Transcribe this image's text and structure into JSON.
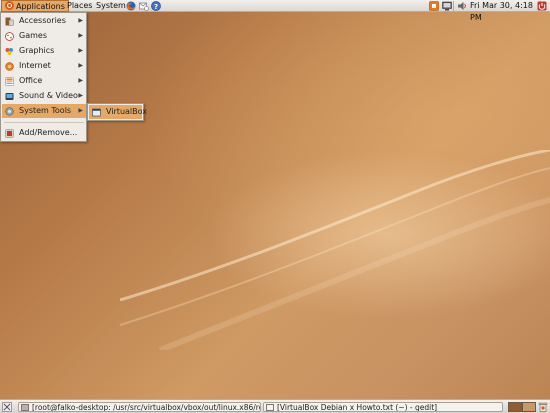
{
  "top_panel": {
    "menus": [
      "Applications",
      "Places",
      "System"
    ],
    "clock": "Fri Mar 30,  4:18 PM"
  },
  "applications_menu": {
    "items": [
      {
        "label": "Accessories",
        "icon": "accessories-icon",
        "has_submenu": true
      },
      {
        "label": "Games",
        "icon": "games-icon",
        "has_submenu": true
      },
      {
        "label": "Graphics",
        "icon": "graphics-icon",
        "has_submenu": true
      },
      {
        "label": "Internet",
        "icon": "internet-icon",
        "has_submenu": true
      },
      {
        "label": "Office",
        "icon": "office-icon",
        "has_submenu": true
      },
      {
        "label": "Sound & Video",
        "icon": "sound-video-icon",
        "has_submenu": true
      },
      {
        "label": "System Tools",
        "icon": "system-tools-icon",
        "has_submenu": true,
        "highlighted": true
      }
    ],
    "add_remove": "Add/Remove..."
  },
  "submenu": {
    "items": [
      {
        "label": "VirtualBox",
        "icon": "virtualbox-icon"
      }
    ]
  },
  "taskbar": {
    "windows": [
      {
        "label": "[root@falko-desktop: /usr/src/virtualbox/vbox/out/linux.x86/relea...",
        "icon": "terminal-icon"
      },
      {
        "label": "[VirtualBox Debian x Howto.txt (~) - gedit]",
        "icon": "text-editor-icon"
      }
    ]
  },
  "colors": {
    "accent": "#e6a866",
    "ubuntu_orange": "#e05a14"
  }
}
